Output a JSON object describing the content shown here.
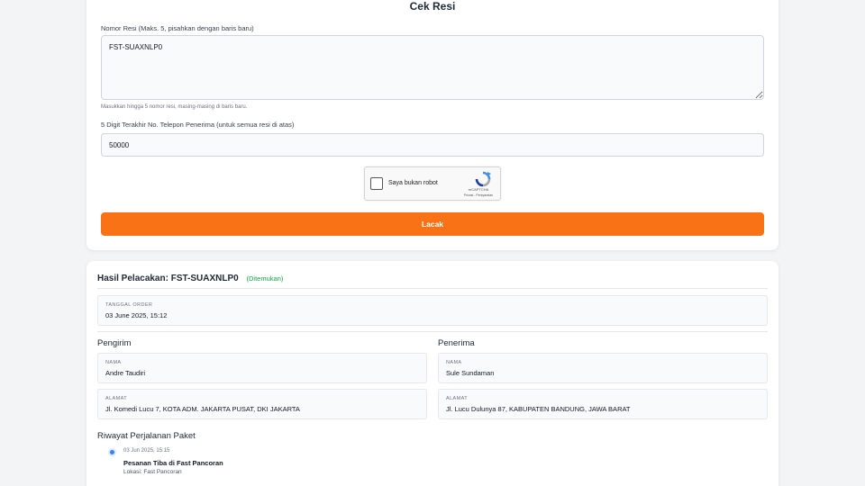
{
  "form": {
    "title": "Cek Resi",
    "resi_label": "Nomor Resi (Maks. 5, pisahkan dengan baris baru)",
    "resi_value": "FST-SUAXNLP0",
    "resi_hint": "Masukkan hingga 5 nomor resi, masing-masing di baris baru.",
    "phone_label": "5 Digit Terakhir No. Telepon Penerima (untuk semua resi di atas)",
    "phone_value": "50000",
    "captcha_label": "Saya bukan robot",
    "captcha_brand": "reCAPTCHA",
    "captcha_links": "Privasi - Persyaratan",
    "submit_label": "Lacak",
    "accent_color": "#f97316"
  },
  "result": {
    "title": "Hasil Pelacakan: FST-SUAXNLP0",
    "status": "(Ditemukan)",
    "order_date_label": "TANGGAL ORDER",
    "order_date": "03 June 2025, 15:12",
    "sender": {
      "title": "Pengirim",
      "name_label": "NAMA",
      "name": "Andre Taudiri",
      "address_label": "ALAMAT",
      "address": "Jl. Komedi Lucu 7, KOTA ADM. JAKARTA PUSAT, DKI JAKARTA"
    },
    "receiver": {
      "title": "Penerima",
      "name_label": "NAMA",
      "name": "Sule Sundaman",
      "address_label": "ALAMAT",
      "address": "Jl. Lucu Dulunya 87, KABUPATEN BANDUNG, JAWA BARAT"
    },
    "history_title": "Riwayat Perjalanan Paket",
    "history": [
      {
        "time": "03 Jun 2025, 15:15",
        "event": "Pesanan Tiba di Fast Pancoran",
        "location": "Lokasi: Fast Pancoran"
      }
    ]
  }
}
